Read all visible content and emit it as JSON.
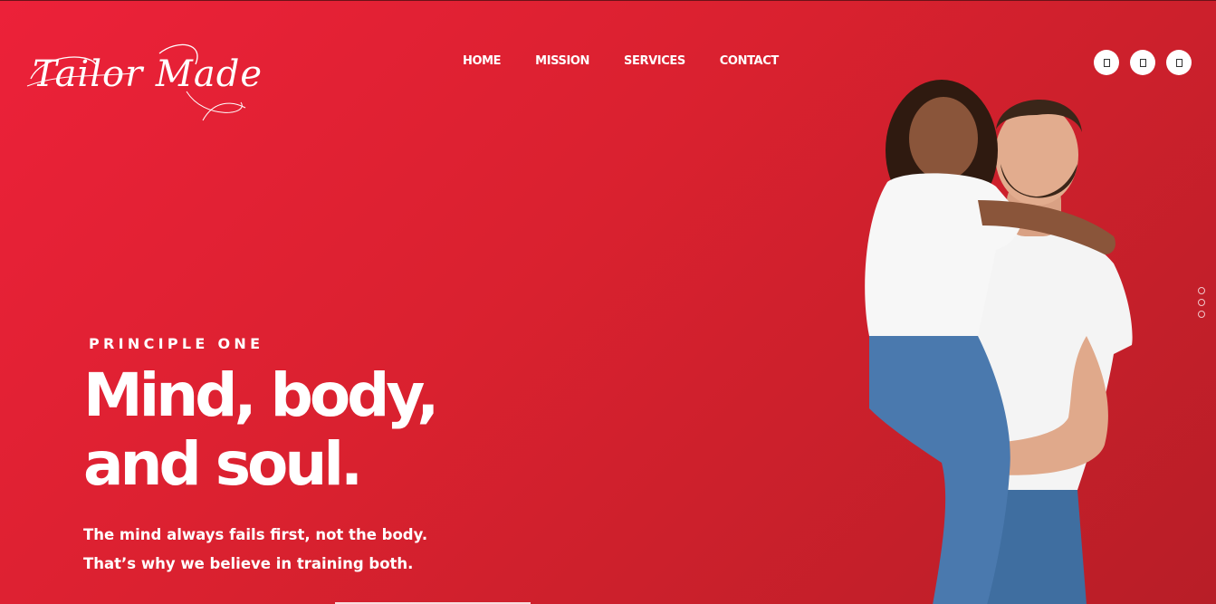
{
  "brand": {
    "logo_text": "Tailor Made"
  },
  "nav": {
    "items": [
      {
        "label": "HOME"
      },
      {
        "label": "MISSION"
      },
      {
        "label": "SERVICES"
      },
      {
        "label": "CONTACT"
      }
    ]
  },
  "social": [
    {
      "icon": "social-icon-1"
    },
    {
      "icon": "social-icon-2"
    },
    {
      "icon": "social-icon-3"
    }
  ],
  "hero": {
    "eyebrow": "PRINCIPLE ONE",
    "headline_line1": "Mind, body,",
    "headline_line2": "and soul.",
    "lead_line1": "The mind always fails first, not the body.",
    "lead_line2": "That’s why we believe in training both."
  },
  "slider": {
    "slides": 3,
    "active": 1
  },
  "colors": {
    "background_start": "#ec2139",
    "background_end": "#b81e27",
    "text": "#ffffff"
  }
}
